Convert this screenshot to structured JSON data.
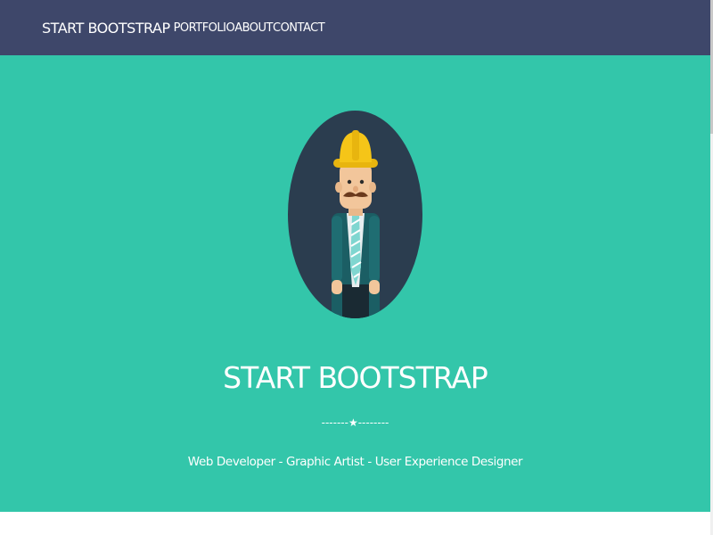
{
  "nav": {
    "brand": "START BOOTSTRAP",
    "links": [
      {
        "label": "PORTFOLIO"
      },
      {
        "label": "ABOUT"
      },
      {
        "label": "CONTACT"
      }
    ]
  },
  "hero": {
    "title": "START BOOTSTRAP",
    "divider": "-------★--------",
    "tagline": "Web Developer - Graphic Artist - User Experience Designer",
    "avatar_icon": "construction-worker-avatar"
  },
  "colors": {
    "nav_bg": "#3e476a",
    "hero_bg": "#33c6aa",
    "avatar_bg": "#2b3d4f",
    "text": "#ffffff"
  }
}
